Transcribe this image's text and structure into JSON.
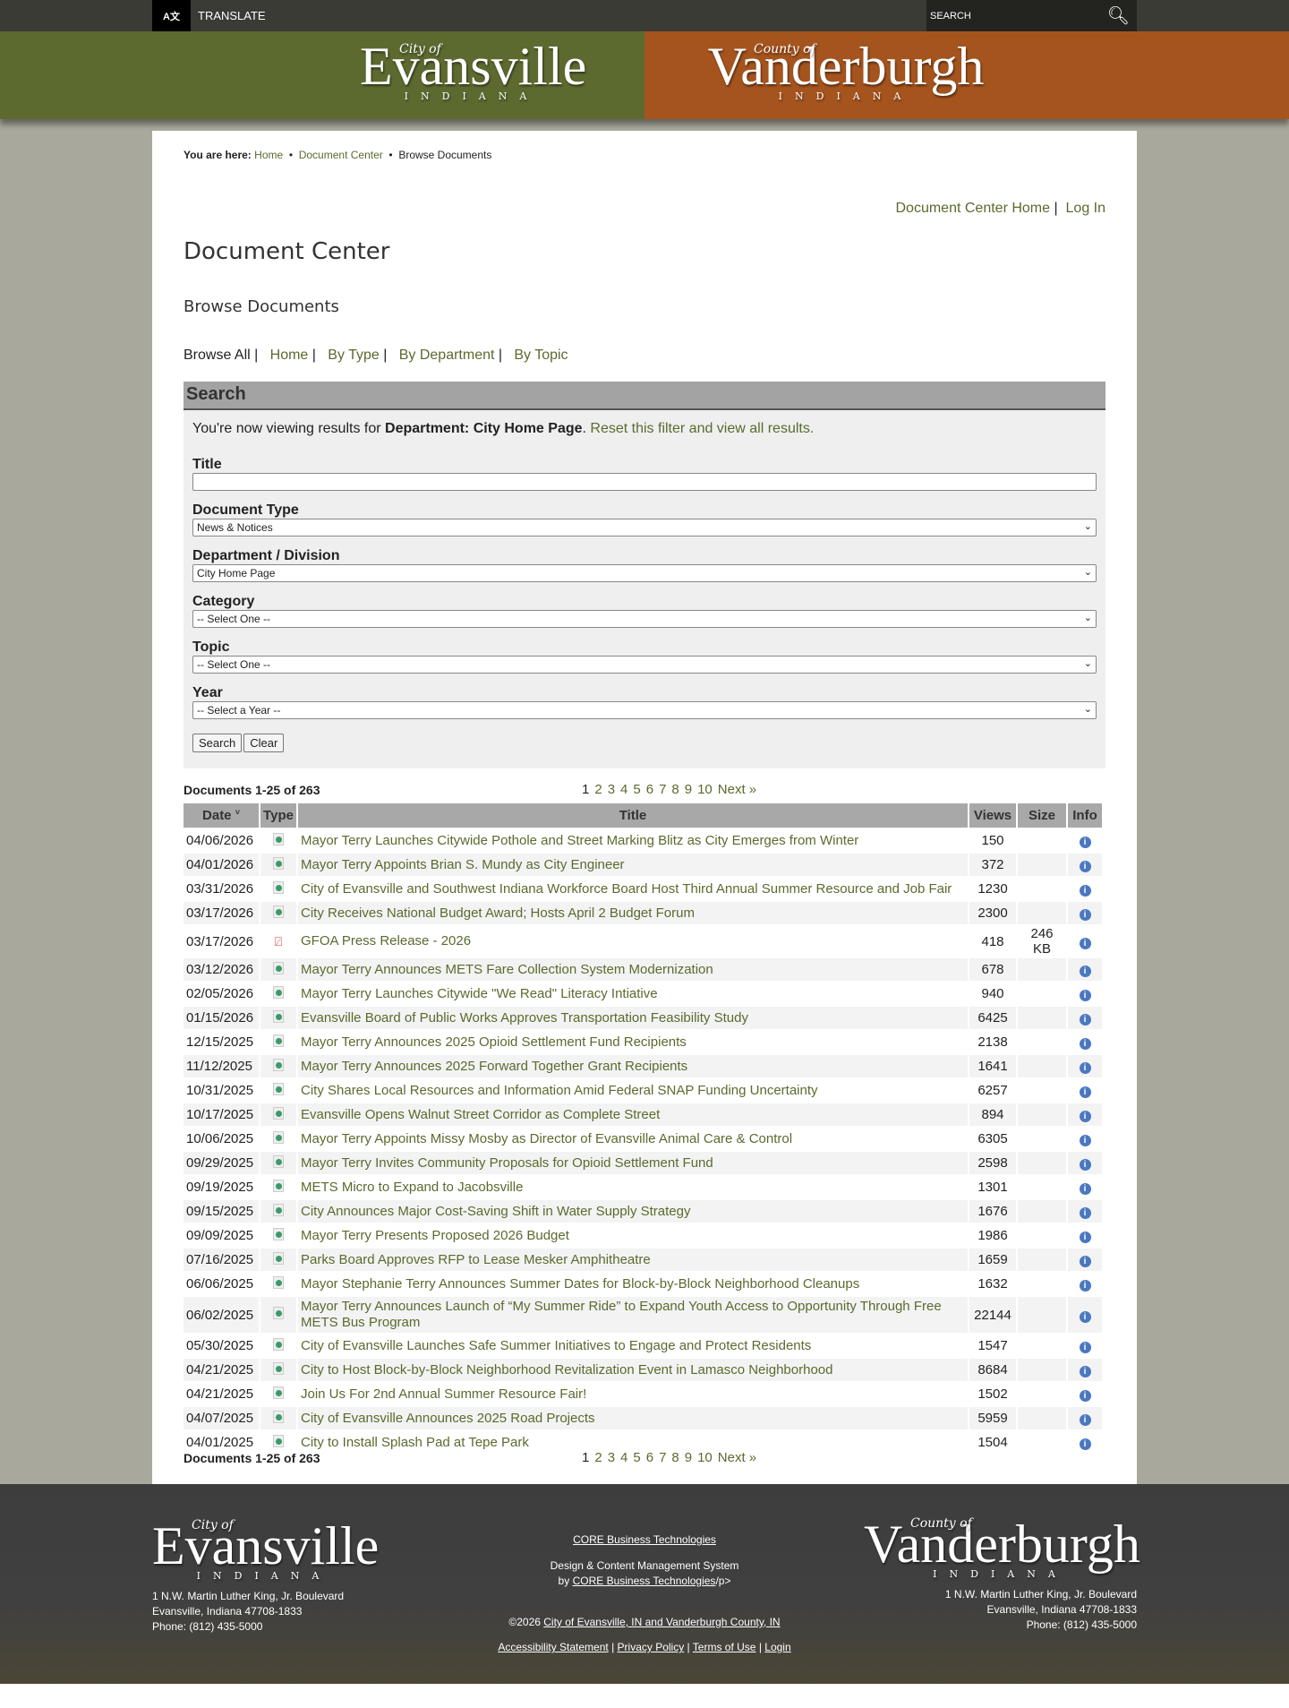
{
  "topbar": {
    "translate": "TRANSLATE",
    "az": "A文",
    "search_placeholder": "SEARCH"
  },
  "banner": {
    "city_of": "City of",
    "city": "Evansville",
    "state": "INDIANA",
    "county_of": "County of",
    "county": "Vanderburgh"
  },
  "breadcrumb": {
    "label": "You are here:",
    "items": [
      "Home",
      "Document Center",
      "Browse Documents"
    ]
  },
  "toplinks": [
    "Document Center Home",
    "Log In"
  ],
  "title": "Document Center",
  "subtitle": "Browse Documents",
  "browse": [
    "Browse All",
    "Home",
    "By Type",
    "By Department",
    "By Topic"
  ],
  "search": {
    "heading": "Search",
    "msg_pre": "You're now viewing results for ",
    "msg_bold": "Department: City Home Page",
    "msg_post": ". ",
    "reset": "Reset this filter and view all results.",
    "fields": [
      {
        "label": "Title",
        "value": ""
      },
      {
        "label": "Document Type",
        "value": "News & Notices"
      },
      {
        "label": "Department / Division",
        "value": "City Home Page"
      },
      {
        "label": "Category",
        "value": "-- Select One --"
      },
      {
        "label": "Topic",
        "value": "-- Select One --"
      },
      {
        "label": "Year",
        "value": "-- Select a Year --"
      }
    ],
    "search_btn": "Search",
    "clear_btn": "Clear"
  },
  "count": "Documents 1-25 of 263",
  "pager": [
    "1",
    "2",
    "3",
    "4",
    "5",
    "6",
    "7",
    "8",
    "9",
    "10",
    "Next »"
  ],
  "table": {
    "headers": [
      "Date",
      "Type",
      "Title",
      "Views",
      "Size",
      "Info"
    ],
    "rows": [
      [
        "04/06/2026",
        "web",
        "Mayor Terry Launches Citywide Pothole and Street Marking Blitz as City Emerges from Winter",
        "150",
        ""
      ],
      [
        "04/01/2026",
        "web",
        "Mayor Terry Appoints Brian S. Mundy as City Engineer",
        "372",
        ""
      ],
      [
        "03/31/2026",
        "web",
        "City of Evansville and Southwest Indiana Workforce Board Host Third Annual Summer Resource and Job Fair",
        "1230",
        ""
      ],
      [
        "03/17/2026",
        "web",
        "City Receives National Budget Award; Hosts April 2 Budget Forum",
        "2300",
        ""
      ],
      [
        "03/17/2026",
        "pdf",
        "GFOA Press Release - 2026",
        "418",
        "246 KB"
      ],
      [
        "03/12/2026",
        "web",
        "Mayor Terry Announces METS Fare Collection System Modernization",
        "678",
        ""
      ],
      [
        "02/05/2026",
        "web",
        "Mayor Terry Launches Citywide \"We Read\" Literacy Intiative",
        "940",
        ""
      ],
      [
        "01/15/2026",
        "web",
        "Evansville Board of Public Works Approves Transportation Feasibility Study",
        "6425",
        ""
      ],
      [
        "12/15/2025",
        "web",
        "Mayor Terry Announces 2025 Opioid Settlement Fund Recipients",
        "2138",
        ""
      ],
      [
        "11/12/2025",
        "web",
        "Mayor Terry Announces 2025 Forward Together Grant Recipients",
        "1641",
        ""
      ],
      [
        "10/31/2025",
        "web",
        "City Shares Local Resources and Information Amid Federal SNAP Funding Uncertainty",
        "6257",
        ""
      ],
      [
        "10/17/2025",
        "web",
        "Evansville Opens Walnut Street Corridor as Complete Street",
        "894",
        ""
      ],
      [
        "10/06/2025",
        "web",
        "Mayor Terry Appoints Missy Mosby as Director of Evansville Animal Care & Control",
        "6305",
        ""
      ],
      [
        "09/29/2025",
        "web",
        "Mayor Terry Invites Community Proposals for Opioid Settlement Fund",
        "2598",
        ""
      ],
      [
        "09/19/2025",
        "web",
        "METS Micro to Expand to Jacobsville",
        "1301",
        ""
      ],
      [
        "09/15/2025",
        "web",
        "City Announces Major Cost-Saving Shift in Water Supply Strategy",
        "1676",
        ""
      ],
      [
        "09/09/2025",
        "web",
        "Mayor Terry Presents Proposed 2026 Budget",
        "1986",
        ""
      ],
      [
        "07/16/2025",
        "web",
        "Parks Board Approves RFP to Lease Mesker Amphitheatre",
        "1659",
        ""
      ],
      [
        "06/06/2025",
        "web",
        "Mayor Stephanie Terry Announces Summer Dates for Block-by-Block Neighborhood Cleanups",
        "1632",
        ""
      ],
      [
        "06/02/2025",
        "web",
        "Mayor Terry Announces Launch of “My Summer Ride” to Expand Youth Access to Opportunity Through Free METS Bus Program",
        "22144",
        ""
      ],
      [
        "05/30/2025",
        "web",
        "City of Evansville Launches Safe Summer Initiatives to Engage and Protect Residents",
        "1547",
        ""
      ],
      [
        "04/21/2025",
        "web",
        "City to Host Block-by-Block Neighborhood Revitalization Event in Lamasco Neighborhood",
        "8684",
        ""
      ],
      [
        "04/21/2025",
        "web",
        "Join Us For 2nd Annual Summer Resource Fair!",
        "1502",
        ""
      ],
      [
        "04/07/2025",
        "web",
        "City of Evansville Announces 2025 Road Projects",
        "5959",
        ""
      ],
      [
        "04/01/2025",
        "web",
        "City to Install Splash Pad at Tepe Park",
        "1504",
        ""
      ]
    ]
  },
  "footer": {
    "core": "CORE Business Technologies",
    "design": "Design & Content Management System",
    "by": "by ",
    "core2": "CORE Business Technologies",
    "tail": "/p>",
    "copy": "©2026 ",
    "copy_link": "City of Evansville, IN and Vanderburgh County, IN",
    "links": [
      "Accessibility Statement",
      "Privacy Policy",
      "Terms of Use",
      "Login"
    ],
    "address": [
      "1 N.W. Martin Luther King, Jr. Boulevard",
      "Evansville, Indiana 47708-1833",
      "Phone: (812) 435-5000"
    ]
  }
}
